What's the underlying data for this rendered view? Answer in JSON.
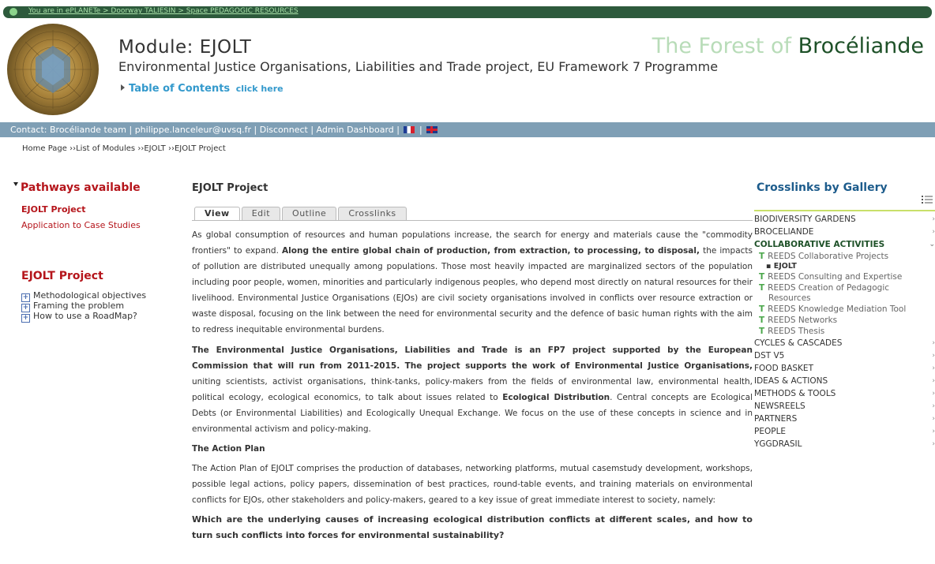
{
  "topbar": {
    "location": "You are in ePLANETe > Doorway TALIESIN > Space PEDAGOGIC RESOURCES"
  },
  "header": {
    "module_title": "Module: EJOLT",
    "subtitle": "Environmental Justice Organisations, Liabilities and Trade project, EU Framework 7 Programme",
    "toc_label": "Table of Contents",
    "toc_click": "click here",
    "brand_part1": "The Forest of ",
    "brand_part2": "Brocéliande"
  },
  "contact": {
    "contact_label": "Contact: Brocéliande team",
    "email": "philippe.lanceleur@uvsq.fr",
    "disconnect": "Disconnect",
    "admin": "Admin Dashboard"
  },
  "breadcrumb": {
    "text": "Home Page ››List of Modules ››EJOLT ››EJOLT Project"
  },
  "sidebar": {
    "pathways_title": "Pathways available",
    "pathway_links": [
      "EJOLT Project",
      "Application to Case Studies"
    ],
    "project_title": "EJOLT Project",
    "tree": [
      "Methodological objectives",
      "Framing the problem",
      "How to use a RoadMap?"
    ]
  },
  "main": {
    "title": "EJOLT Project",
    "tabs": [
      "View",
      "Edit",
      "Outline",
      "Crosslinks"
    ],
    "p1a": "As global consumption of resources and human populations increase, the search for energy and materials cause the \"commodity frontiers\" to expand. ",
    "p1b": "Along the entire global chain of production, from extraction, to processing, to disposal,",
    "p1c": " the impacts of pollution are distributed unequally among populations. Those most heavily impacted are marginalized sectors of the population including poor people, women, minorities and particularly indigenous peoples, who depend most directly on natural resources for their livelihood. Environmental Justice Organisations (EJOs) are civil society organisations involved in conflicts over resource extraction or waste disposal, focusing on the link between the need for environmental security and the defence of basic human rights with the aim to redress inequitable environmental burdens.",
    "p2a": "The Environmental Justice Organisations, Liabilities and Trade is an FP7 project supported by the European Commission that will run from 2011-2015. The project supports the work of Environmental Justice Organisations,",
    "p2b": " uniting scientists, activist organisations, think-tanks, policy-makers from the fields of environmental law, environmental health, political ecology, ecological economics, to talk about issues related to ",
    "p2c": "Ecological Distribution",
    "p2d": ". Central concepts are Ecological Debts (or Environmental Liabilities) and Ecologically Unequal Exchange. We focus on the use of these concepts in science and in environmental activism and policy-making.",
    "h3": "The Action Plan",
    "p3": "The Action Plan of EJOLT comprises the production of databases, networking platforms, mutual casemstudy development, workshops, possible legal actions, policy papers, dissemination of best practices, round-table events, and training materials on environmental conflicts for EJOs, other stakeholders and policy-makers, geared to a key issue of great immediate interest to society, namely:",
    "q": "Which are the underlying causes of increasing ecological distribution conflicts at different scales, and how to turn such conflicts into forces for environmental sustainability?"
  },
  "crosslinks": {
    "title": "Crosslinks by Gallery",
    "cat1": "BIODIVERSITY GARDENS",
    "cat2": "BROCELIANDE",
    "cat3": "COLLABORATIVE ACTIVITIES",
    "sub1": "REEDS Collaborative Projects",
    "subsub1": "EJOLT",
    "sub2": "REEDS Consulting and Expertise",
    "sub3": "REEDS Creation of Pedagogic",
    "sub3b": "Resources",
    "sub4": "REEDS Knowledge Mediation Tool",
    "sub5": "REEDS Networks",
    "sub6": "REEDS Thesis",
    "cat4": "CYCLES & CASCADES",
    "cat5": "DST V5",
    "cat6": "FOOD BASKET",
    "cat7": "IDEAS & ACTIONS",
    "cat8": "METHODS & TOOLS",
    "cat9": "NEWSREELS",
    "cat10": "PARTNERS",
    "cat11": "PEOPLE",
    "cat12": "YGGDRASIL"
  }
}
